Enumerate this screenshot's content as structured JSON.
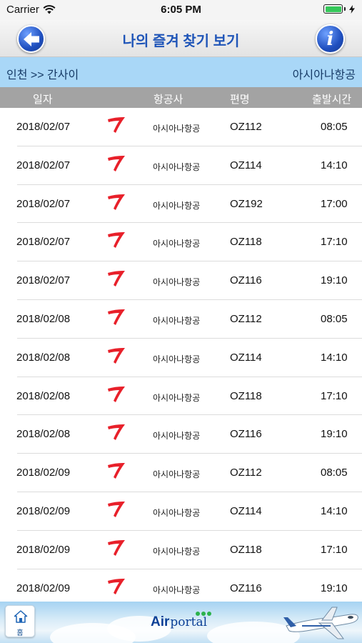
{
  "status_bar": {
    "carrier": "Carrier",
    "time": "6:05 PM"
  },
  "nav": {
    "title": "나의 즐겨 찾기 보기",
    "back_icon": "back-arrow-icon",
    "info_icon": "info-icon",
    "info_glyph": "i"
  },
  "route": {
    "text": "인천 >> 간사이",
    "airline": "아시아나항공"
  },
  "table": {
    "headers": {
      "date": "일자",
      "airline": "항공사",
      "flight": "편명",
      "time": "출발시간"
    },
    "rows": [
      {
        "date": "2018/02/07",
        "airline": "아시아나항공",
        "flight": "OZ112",
        "time": "08:05"
      },
      {
        "date": "2018/02/07",
        "airline": "아시아나항공",
        "flight": "OZ114",
        "time": "14:10"
      },
      {
        "date": "2018/02/07",
        "airline": "아시아나항공",
        "flight": "OZ192",
        "time": "17:00"
      },
      {
        "date": "2018/02/07",
        "airline": "아시아나항공",
        "flight": "OZ118",
        "time": "17:10"
      },
      {
        "date": "2018/02/07",
        "airline": "아시아나항공",
        "flight": "OZ116",
        "time": "19:10"
      },
      {
        "date": "2018/02/08",
        "airline": "아시아나항공",
        "flight": "OZ112",
        "time": "08:05"
      },
      {
        "date": "2018/02/08",
        "airline": "아시아나항공",
        "flight": "OZ114",
        "time": "14:10"
      },
      {
        "date": "2018/02/08",
        "airline": "아시아나항공",
        "flight": "OZ118",
        "time": "17:10"
      },
      {
        "date": "2018/02/08",
        "airline": "아시아나항공",
        "flight": "OZ116",
        "time": "19:10"
      },
      {
        "date": "2018/02/09",
        "airline": "아시아나항공",
        "flight": "OZ112",
        "time": "08:05"
      },
      {
        "date": "2018/02/09",
        "airline": "아시아나항공",
        "flight": "OZ114",
        "time": "14:10"
      },
      {
        "date": "2018/02/09",
        "airline": "아시아나항공",
        "flight": "OZ118",
        "time": "17:10"
      },
      {
        "date": "2018/02/09",
        "airline": "아시아나항공",
        "flight": "OZ116",
        "time": "19:10"
      }
    ]
  },
  "tab_bar": {
    "home_label": "홈",
    "brand_air": "Air",
    "brand_portal": "portal"
  },
  "colors": {
    "nav_title": "#1f55b8",
    "route_bar": "#a9d7f7",
    "header_bar": "#a3a3a3",
    "asiana_red": "#e8202a"
  }
}
